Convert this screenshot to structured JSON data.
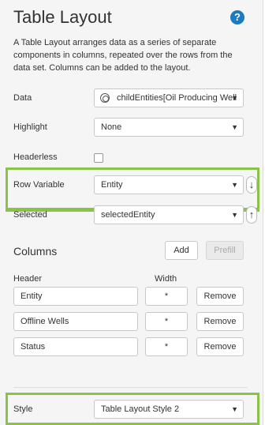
{
  "header": {
    "title": "Table Layout",
    "help_icon": "question-circle-icon",
    "help_glyph": "?",
    "description": "A Table Layout arranges data as a series of separate components in columns, repeated over the rows from the data set. Columns can be added to the layout."
  },
  "fields": {
    "data": {
      "label": "Data",
      "value": "childEntities[Oil Producing Well",
      "icon": "datasource-icon"
    },
    "highlight": {
      "label": "Highlight",
      "value": "None"
    },
    "headerless": {
      "label": "Headerless",
      "checked": false
    },
    "row_variable": {
      "label": "Row Variable",
      "value": "Entity",
      "side_icon": "arrow-down-icon",
      "side_glyph": "↓"
    },
    "selected": {
      "label": "Selected",
      "value": "selectedEntity",
      "side_icon": "arrow-up-icon",
      "side_glyph": "↑"
    }
  },
  "columns": {
    "title": "Columns",
    "add_label": "Add",
    "prefill_label": "Prefill",
    "header_label": "Header",
    "width_label": "Width",
    "rows": [
      {
        "header": "Entity",
        "width": "*",
        "remove": "Remove"
      },
      {
        "header": "Offline Wells",
        "width": "*",
        "remove": "Remove"
      },
      {
        "header": "Status",
        "width": "*",
        "remove": "Remove"
      }
    ]
  },
  "style": {
    "label": "Style",
    "value": "Table Layout Style 2"
  },
  "dropdown_arrow": "▼",
  "colors": {
    "highlight_border": "#8bc34a",
    "help": "#1a7bc0",
    "panel_bg": "#f5f5f5"
  }
}
